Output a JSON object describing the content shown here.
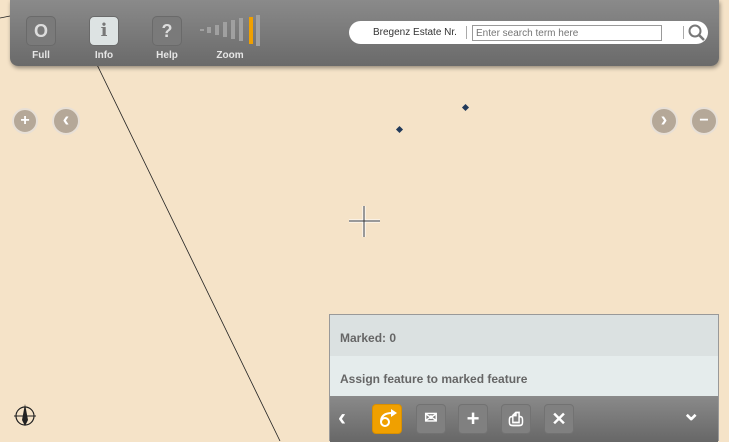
{
  "toolbar": {
    "buttons": [
      {
        "label": "Full",
        "icon": "circle-icon",
        "glyph": "O"
      },
      {
        "label": "Info",
        "icon": "info-icon",
        "glyph": "i"
      },
      {
        "label": "Help",
        "icon": "help-icon",
        "glyph": "?"
      }
    ],
    "zoom_label": "Zoom",
    "zoom_level": 8,
    "zoom_levels": 9
  },
  "search": {
    "label": "Bregenz Estate Nr.",
    "placeholder": "Enter search term here"
  },
  "nav": {
    "zoom_in": "+",
    "back": "‹",
    "forward": "›",
    "zoom_out": "−"
  },
  "panel": {
    "marked": "Marked: 0",
    "assign": "Assign feature to marked feature",
    "buttons": {
      "back": "‹",
      "email": "✉",
      "add": "+",
      "print": "⎙",
      "close": "✕",
      "collapse": "⌄"
    }
  },
  "colors": {
    "accent": "#f0a000",
    "map": "#f5e3c8"
  }
}
